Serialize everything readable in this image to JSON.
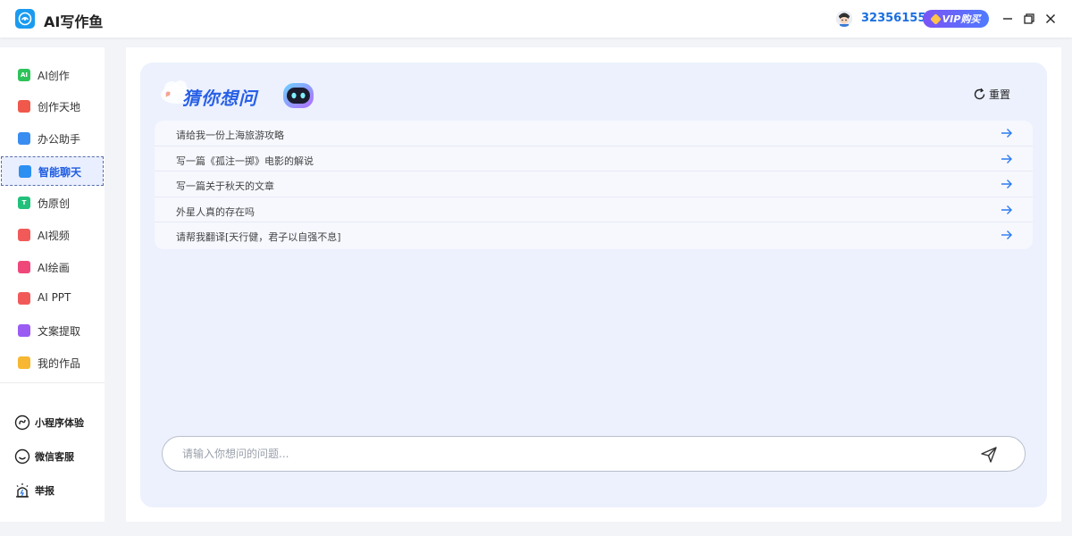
{
  "app": {
    "title": "AI写作鱼"
  },
  "user": {
    "id": "32356155",
    "vip_label": "VIP购买"
  },
  "colors": {
    "accent": "#2860e6",
    "vip_start": "#7b53f5",
    "vip_end": "#4f7bff",
    "card_bg": "#ecf1fd"
  },
  "sidebar": {
    "items": [
      {
        "label": "AI创作",
        "icon": "ai-create-icon",
        "color": "#2ec35a",
        "glyph": "AI"
      },
      {
        "label": "创作天地",
        "icon": "pencil-icon",
        "color": "#f0584c",
        "glyph": ""
      },
      {
        "label": "办公助手",
        "icon": "briefcase-icon",
        "color": "#3a8df0",
        "glyph": ""
      },
      {
        "label": "智能聊天",
        "icon": "chat-bot-icon",
        "color": "#2c8ff2",
        "glyph": ""
      },
      {
        "label": "伪原创",
        "icon": "text-t-icon",
        "color": "#22c07a",
        "glyph": "T"
      },
      {
        "label": "AI视频",
        "icon": "video-icon",
        "color": "#f25a5a",
        "glyph": ""
      },
      {
        "label": "AI绘画",
        "icon": "palette-icon",
        "color": "#f0477a",
        "glyph": ""
      },
      {
        "label": "AI PPT",
        "icon": "ppt-icon",
        "color": "#f25a5a",
        "glyph": ""
      },
      {
        "label": "文案提取",
        "icon": "extract-icon",
        "color": "#9a5cf2",
        "glyph": ""
      },
      {
        "label": "我的作品",
        "icon": "folder-icon",
        "color": "#f7b733",
        "glyph": ""
      }
    ],
    "active_index": 3,
    "extras": [
      {
        "label": "小程序体验",
        "icon": "mini-program-icon"
      },
      {
        "label": "微信客服",
        "icon": "wechat-service-icon"
      },
      {
        "label": "举报",
        "icon": "report-icon"
      }
    ]
  },
  "chat": {
    "heading": "猜你想问",
    "reset_label": "重置",
    "suggestions": [
      "请给我一份上海旅游攻略",
      "写一篇《孤注一掷》电影的解说",
      "写一篇关于秋天的文章",
      "外星人真的存在吗",
      "请帮我翻译[天行健，君子以自强不息]"
    ],
    "input_placeholder": "请输入你想问的问题..."
  }
}
